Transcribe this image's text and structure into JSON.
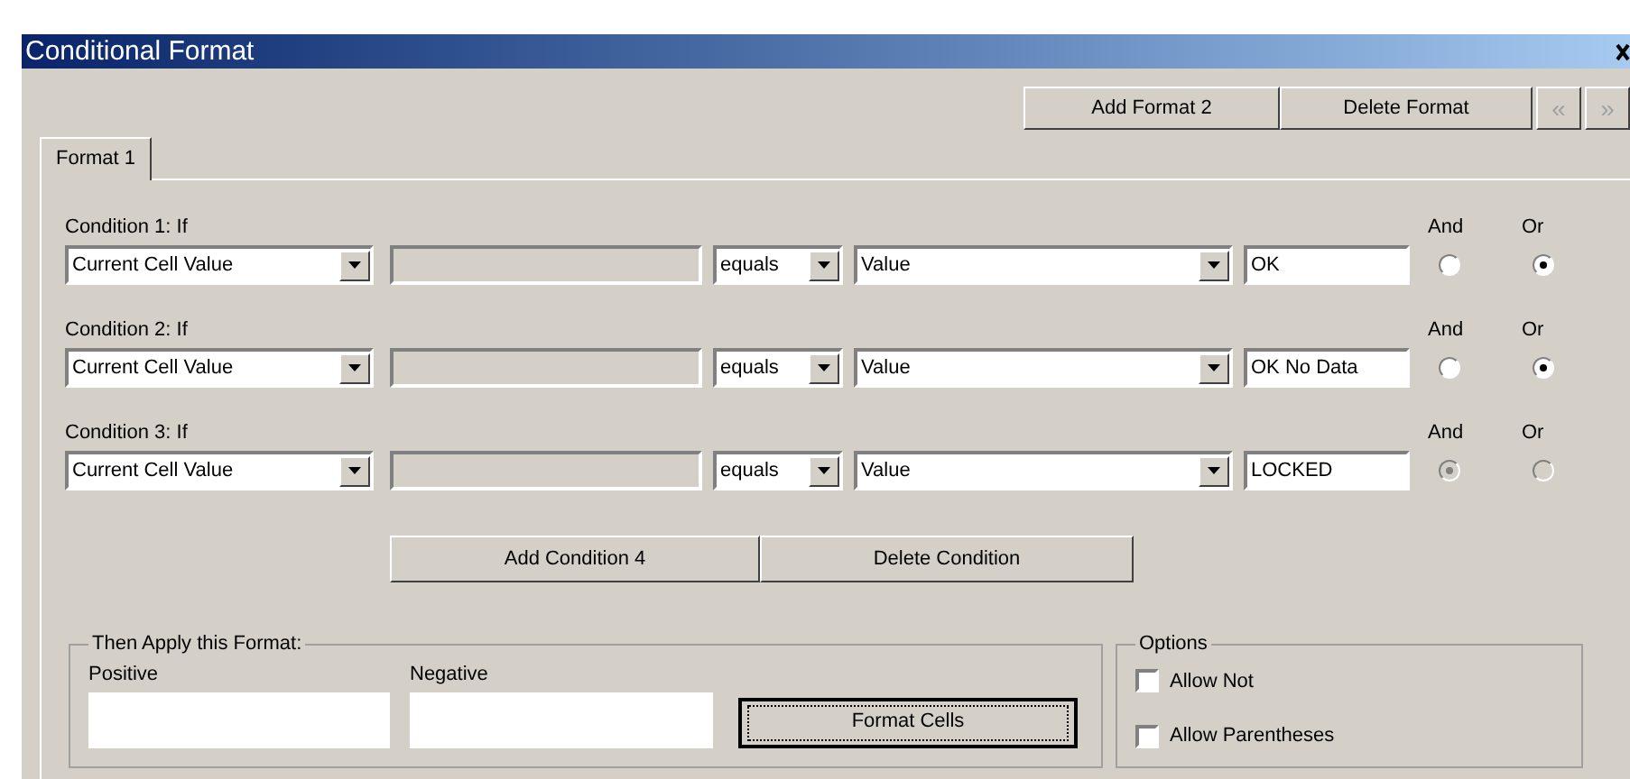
{
  "window": {
    "title": "Conditional Format"
  },
  "toolbar": {
    "buttons": [
      "Add Format 2",
      "Delete Format"
    ],
    "nav": [
      {
        "label": "«",
        "disabled": true
      },
      {
        "label": "»",
        "disabled": true
      }
    ]
  },
  "tabs": [
    {
      "label": "Format 1",
      "selected": true
    }
  ],
  "conditions": [
    {
      "label": "Condition 1: If",
      "field": "Current Cell Value",
      "operator": "equals",
      "type": "Value",
      "value": "OK",
      "and_label": "And",
      "or_label": "Or",
      "and_selected": false,
      "or_selected": true,
      "disabled": false
    },
    {
      "label": "Condition 2: If",
      "field": "Current Cell Value",
      "operator": "equals",
      "type": "Value",
      "value": "OK No Data",
      "and_label": "And",
      "or_label": "Or",
      "and_selected": false,
      "or_selected": true,
      "disabled": false
    },
    {
      "label": "Condition 3: If",
      "field": "Current Cell Value",
      "operator": "equals",
      "type": "Value",
      "value": "LOCKED",
      "and_label": "And",
      "or_label": "Or",
      "and_selected": true,
      "or_selected": false,
      "disabled": true
    }
  ],
  "condition_buttons": [
    "Add Condition 4",
    "Delete Condition"
  ],
  "apply_format": {
    "title": "Then Apply this Format:",
    "positive_label": "Positive",
    "negative_label": "Negative",
    "button": "Format Cells"
  },
  "options": {
    "title": "Options",
    "items": [
      {
        "label": "Allow Not",
        "checked": false
      },
      {
        "label": "Allow Parentheses",
        "checked": false
      }
    ]
  }
}
